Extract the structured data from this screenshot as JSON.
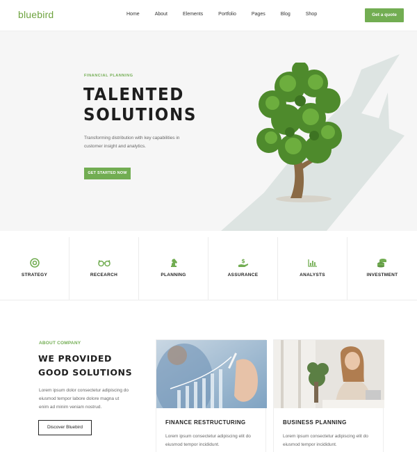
{
  "header": {
    "logo": "bluebird",
    "nav": [
      "Home",
      "About",
      "Elements",
      "Portfolio",
      "Pages",
      "Blog",
      "Shop"
    ],
    "cta_label": "Get a quote"
  },
  "hero": {
    "eyebrow": "FINANCIAL PLANNING",
    "title_line1": "TALENTED",
    "title_line2": "SOLUTIONS",
    "description": "Transforming distribution with key capabilities in customer insight and analytics.",
    "button_label": "GET STARTED NOW"
  },
  "features": [
    {
      "label": "STRATEGY",
      "icon": "target-icon"
    },
    {
      "label": "RECEARCH",
      "icon": "glasses-icon"
    },
    {
      "label": "PLANNING",
      "icon": "chess-knight-icon"
    },
    {
      "label": "ASSURANCE",
      "icon": "hand-money-icon"
    },
    {
      "label": "ANALYSTS",
      "icon": "bar-chart-icon"
    },
    {
      "label": "INVESTMENT",
      "icon": "coins-icon"
    }
  ],
  "about": {
    "eyebrow": "ABOUT COMPANY",
    "title": "WE PROVIDED GOOD SOLUTIONS",
    "description": "Lorem ipsum dolor consectetur adipiscing do eiusmod tempor labore dolore magna ut enim ad minim veniam nostrud.",
    "button_label": "Discover Bluebird"
  },
  "cards": [
    {
      "title": "FINANCE RESTRUCTURING",
      "description": "Lorem ipsum consectetur adipiscing elit do eiusmod tempor incididunt."
    },
    {
      "title": "BUSINESS PLANNING",
      "description": "Lorem ipsum consectetur adipiscing elit do eiusmod tempor incididunt."
    }
  ],
  "colors": {
    "accent": "#72ad52",
    "heading": "#1e1e1e",
    "hero_bg": "#f6f6f6"
  }
}
